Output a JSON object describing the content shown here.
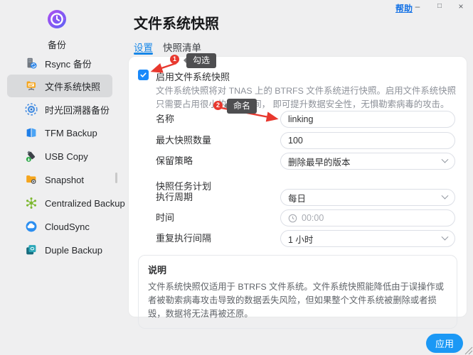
{
  "window": {
    "help_label": "帮助",
    "controls": {
      "minimize": "–",
      "maximize": "□",
      "close": "×"
    }
  },
  "sidebar": {
    "app": {
      "label": "备份",
      "icon": "clock-backup-icon"
    },
    "items": [
      {
        "label": "Rsync 备份",
        "icon": "server-sync-icon",
        "selected": false
      },
      {
        "label": "文件系统快照",
        "icon": "folder-network-icon",
        "selected": true
      },
      {
        "label": "时光回溯器备份",
        "icon": "time-machine-icon",
        "selected": false
      },
      {
        "label": "TFM Backup",
        "icon": "open-book-icon",
        "selected": false
      },
      {
        "label": "USB Copy",
        "icon": "usb-drive-icon",
        "selected": false
      },
      {
        "label": "Snapshot",
        "icon": "folder-camera-icon",
        "selected": false
      },
      {
        "label": "Centralized Backup",
        "icon": "network-hub-icon",
        "selected": false
      },
      {
        "label": "CloudSync",
        "icon": "cloud-icon",
        "selected": false
      },
      {
        "label": "Duple Backup",
        "icon": "stacked-copy-icon",
        "selected": false
      }
    ]
  },
  "main": {
    "title": "文件系统快照",
    "tabs": [
      {
        "label": "设置",
        "active": true
      },
      {
        "label": "快照清单",
        "active": false
      }
    ],
    "enable": {
      "label": "启用文件系统快照",
      "checked": true
    },
    "description": "文件系统快照将对 TNAS 上的 BTRFS 文件系统进行快照。启用文件系统快照只需要占用很小的存储空间， 即可提升数据安全性，无惧勒索病毒的攻击。",
    "form": {
      "name": {
        "label": "名称",
        "value": "linking"
      },
      "max_snapshots": {
        "label": "最大快照数量",
        "value": "100"
      },
      "retention": {
        "label": "保留策略",
        "value": "删除最早的版本"
      },
      "schedule_section": "快照任务计划",
      "period": {
        "label": "执行周期",
        "value": "每日"
      },
      "time": {
        "label": "时间",
        "value": "00:00"
      },
      "repeat": {
        "label": "重复执行间隔",
        "value": "1 小时"
      }
    },
    "note": {
      "title": "说明",
      "text": "文件系统快照仅适用于 BTRFS 文件系统。文件系统快照能降低由于误操作或者被勒索病毒攻击导致的数据丢失风险，但如果整个文件系统被删除或者损毁，数据将无法再被还原。"
    },
    "apply_label": "应用"
  },
  "annotations": [
    {
      "number": "1",
      "label": "勾选"
    },
    {
      "number": "2",
      "label": "命名"
    }
  ],
  "colors": {
    "accent_blue": "#1989fa",
    "link_blue": "#1673e6",
    "annotation_red": "#e8382e",
    "tooltip_bg": "#4e4e50",
    "sidebar_selected": "#d9dadc"
  }
}
